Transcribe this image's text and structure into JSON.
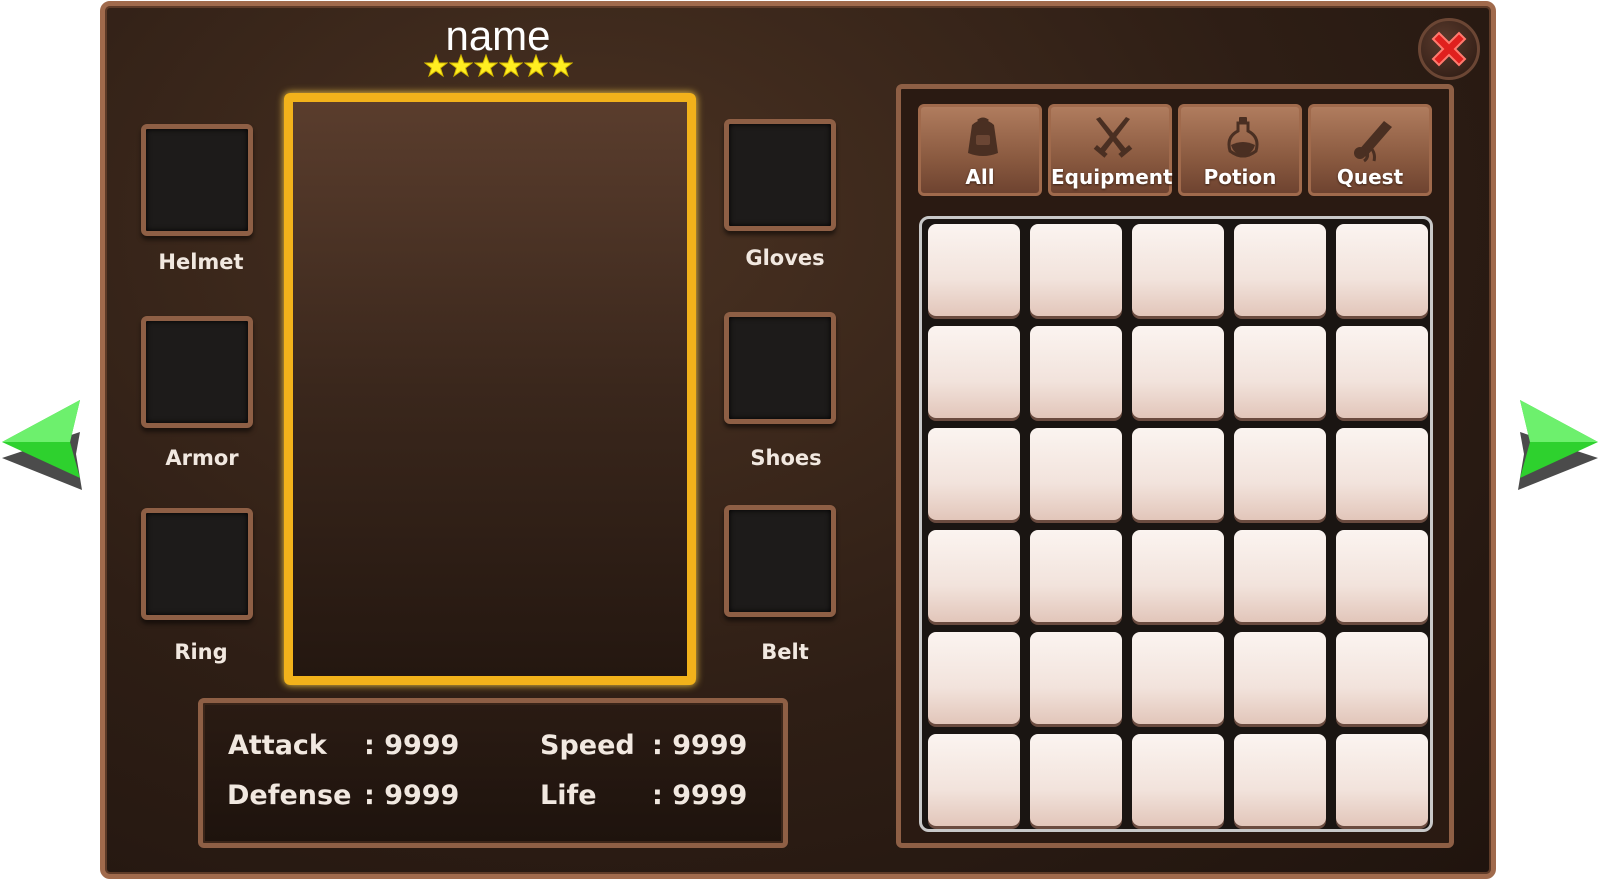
{
  "header": {
    "title": "name",
    "star_count": 6,
    "star_color": "#ffee22"
  },
  "equipment": {
    "left_slots": [
      {
        "label": "Helmet"
      },
      {
        "label": "Armor"
      },
      {
        "label": "Ring"
      }
    ],
    "right_slots": [
      {
        "label": "Gloves"
      },
      {
        "label": "Shoes"
      },
      {
        "label": "Belt"
      }
    ]
  },
  "stats": {
    "attack_label": "Attack",
    "attack_value": ": 9999",
    "speed_label": "Speed",
    "speed_value": ": 9999",
    "defense_label": "Defense",
    "defense_value": ": 9999",
    "life_label": "Life",
    "life_value": ": 9999"
  },
  "inventory": {
    "tabs": [
      {
        "label": "All",
        "icon": "backpack-icon"
      },
      {
        "label": "Equipment",
        "icon": "crossed-swords-icon"
      },
      {
        "label": "Potion",
        "icon": "potion-flask-icon"
      },
      {
        "label": "Quest",
        "icon": "scroll-icon"
      }
    ],
    "rows": 6,
    "columns": 5
  },
  "colors": {
    "panel_border": "#a06a4c",
    "portrait_frame": "#f2b21b",
    "nav_arrow": "#2ecc2e",
    "close_button": "#e0201e"
  }
}
